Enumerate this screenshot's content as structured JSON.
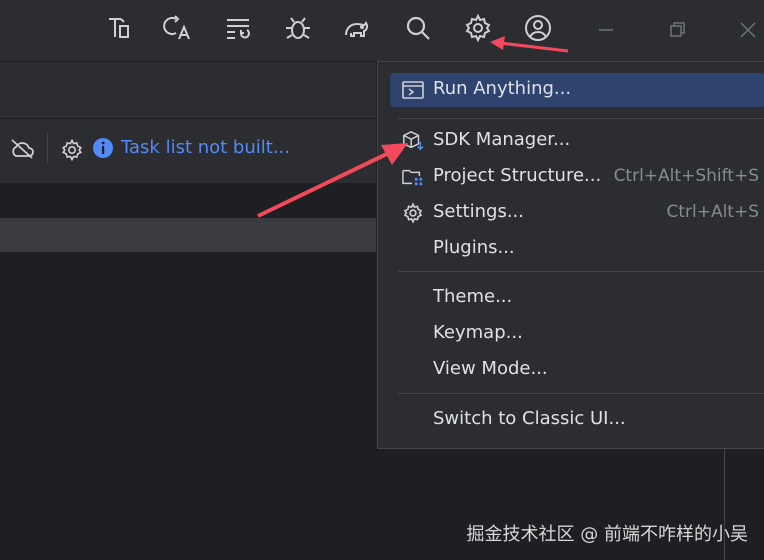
{
  "toolbar": {
    "icons": [
      "build-icon",
      "translate-icon",
      "changes-icon",
      "debug-icon",
      "elephant-icon",
      "search-icon",
      "settings-icon",
      "account-icon"
    ]
  },
  "window_controls": [
    "minimize",
    "restore",
    "close"
  ],
  "status": {
    "task_link": "Task list not built..."
  },
  "menu": {
    "items": [
      {
        "label": "Run Anything...",
        "shortcut": "",
        "icon": "run-anything-icon",
        "highlighted": true
      },
      {
        "label": "SDK Manager...",
        "shortcut": "",
        "icon": "sdk-cube-icon"
      },
      {
        "label": "Project Structure...",
        "shortcut": "Ctrl+Alt+Shift+S",
        "icon": "project-structure-icon"
      },
      {
        "label": "Settings...",
        "shortcut": "Ctrl+Alt+S",
        "icon": "settings-gear-icon"
      },
      {
        "label": "Plugins...",
        "shortcut": ""
      },
      {
        "label": "Theme...",
        "shortcut": ""
      },
      {
        "label": "Keymap...",
        "shortcut": ""
      },
      {
        "label": "View Mode...",
        "shortcut": ""
      },
      {
        "label": "Switch to Classic UI...",
        "shortcut": ""
      }
    ]
  },
  "colors": {
    "highlight": "#2e436e",
    "link": "#548af7",
    "arrow": "#f2495c"
  },
  "watermark": "掘金技术社区 @ 前端不咋样的小吴"
}
